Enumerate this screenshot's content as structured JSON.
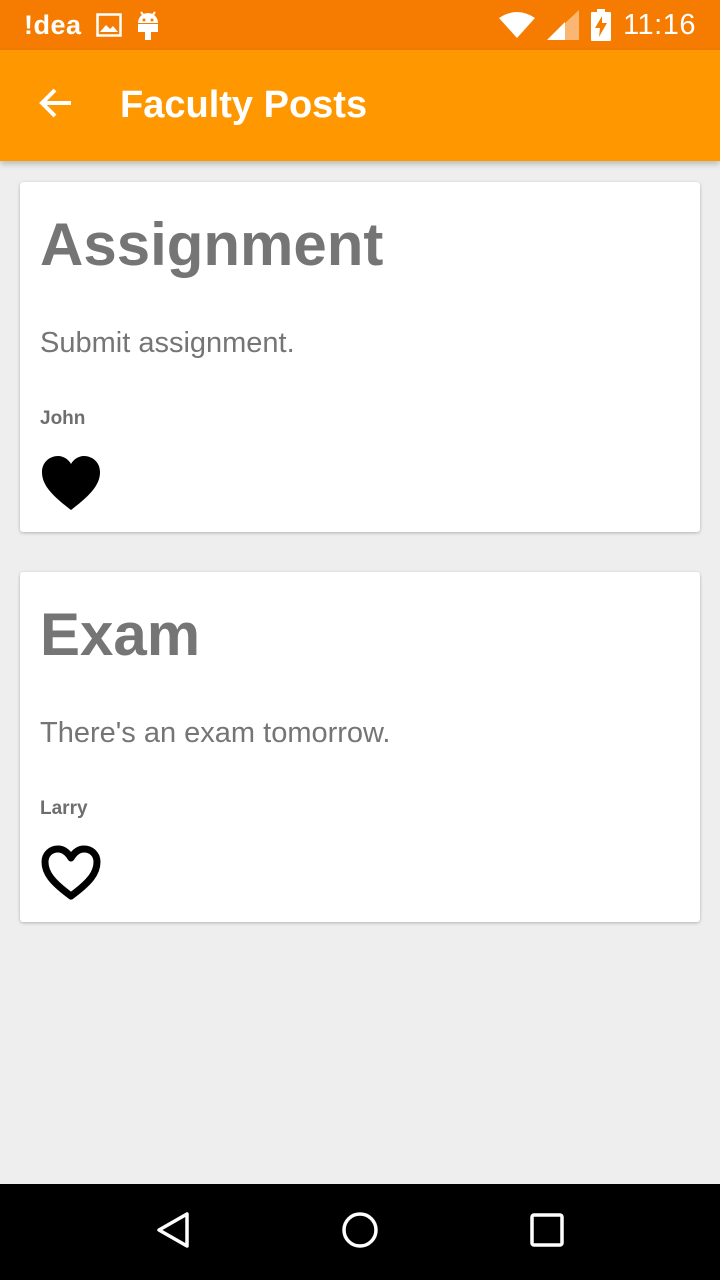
{
  "status_bar": {
    "carrier": "!dea",
    "time": "11:16",
    "icons": [
      "image-icon",
      "android-icon",
      "wifi-icon",
      "signal-icon",
      "battery-charging-icon"
    ]
  },
  "app_bar": {
    "title": "Faculty Posts",
    "back_icon": "arrow-back-icon",
    "color": "#ff9800"
  },
  "posts": [
    {
      "title": "Assignment",
      "body": "Submit assignment.",
      "author": "John",
      "liked": true
    },
    {
      "title": "Exam",
      "body": "There's an exam tomorrow.",
      "author": "Larry",
      "liked": false
    }
  ],
  "nav_bar": {
    "buttons": [
      "back-triangle-icon",
      "home-circle-icon",
      "recents-square-icon"
    ]
  },
  "colors": {
    "status_bar": "#f57c00",
    "app_bar": "#ff9800",
    "background": "#eeeeee",
    "text_gray": "#757575"
  }
}
